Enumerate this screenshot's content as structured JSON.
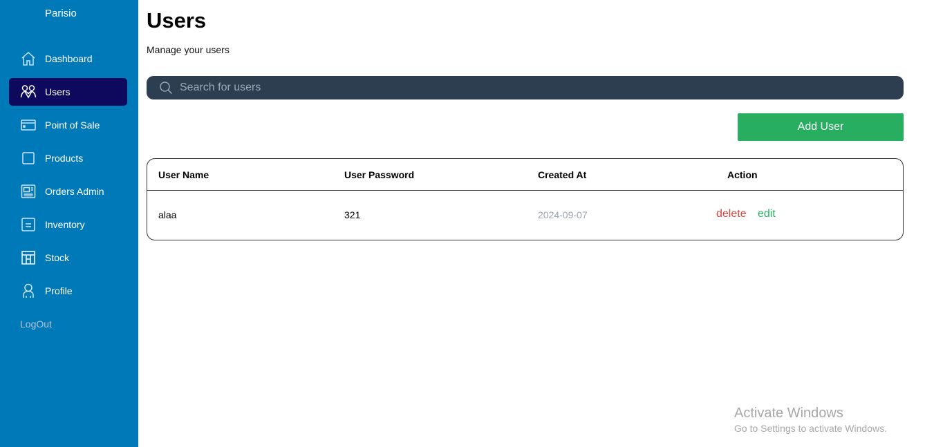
{
  "sidebar": {
    "brand": "Parisio",
    "items": [
      {
        "label": "Dashboard",
        "icon": "home-icon",
        "active": false
      },
      {
        "label": "Users",
        "icon": "users-icon",
        "active": true
      },
      {
        "label": "Point of Sale",
        "icon": "card-icon",
        "active": false
      },
      {
        "label": "Products",
        "icon": "square-icon",
        "active": false
      },
      {
        "label": "Orders Admin",
        "icon": "register-icon",
        "active": false
      },
      {
        "label": "Inventory",
        "icon": "inventory-icon",
        "active": false
      },
      {
        "label": "Stock",
        "icon": "grid-icon",
        "active": false
      },
      {
        "label": "Profile",
        "icon": "person-icon",
        "active": false
      }
    ],
    "logout": "LogOut"
  },
  "header": {
    "title": "Users",
    "subtitle": "Manage your users"
  },
  "search": {
    "placeholder": "Search for users",
    "value": ""
  },
  "actions": {
    "add_user": "Add User"
  },
  "table": {
    "columns": [
      "User Name",
      "User Password",
      "Created At",
      "Action"
    ],
    "rows": [
      {
        "user_name": "alaa",
        "password": "321",
        "created_at": "2024-09-07",
        "delete_label": "delete",
        "edit_label": "edit"
      }
    ]
  },
  "watermark": {
    "title": "Activate Windows",
    "subtitle": "Go to Settings to activate Windows."
  },
  "colors": {
    "sidebar": "#0079b8",
    "active_item": "#0d0a5e",
    "search_bg": "#2d3e50",
    "add_button": "#27ae60",
    "delete": "#e0413a",
    "edit": "#27ae60"
  }
}
